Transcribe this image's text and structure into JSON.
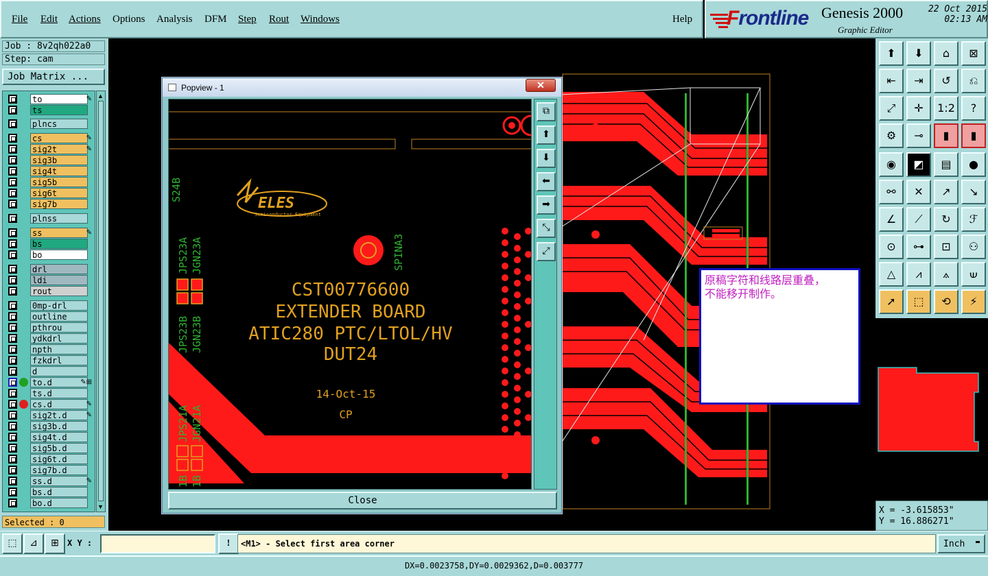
{
  "menu": {
    "file": "File",
    "edit": "Edit",
    "actions": "Actions",
    "options": "Options",
    "analysis": "Analysis",
    "dfm": "DFM",
    "step": "Step",
    "rout": "Rout",
    "windows": "Windows",
    "help": "Help"
  },
  "brand": {
    "logo_f": "F",
    "logo_rest": "rontline",
    "product": "Genesis 2000",
    "subtitle": "Graphic Editor",
    "date": "22 Oct 2015",
    "time": "02:13 AM"
  },
  "left": {
    "job": "Job : 8v2qh022a0",
    "step": "Step: cam",
    "job_matrix": "Job Matrix ...",
    "selected": "Selected : 0",
    "layers": [
      {
        "name": "to",
        "color": "#ffffff",
        "mark": "✎"
      },
      {
        "name": "ts",
        "color": "#20a880",
        "mark": ""
      },
      {
        "name": "plncs",
        "color": "#a8d8d8",
        "mark": ""
      },
      {
        "name": "cs",
        "color": "#f0c060",
        "mark": "✎"
      },
      {
        "name": "sig2t",
        "color": "#f0c060",
        "mark": "✎"
      },
      {
        "name": "sig3b",
        "color": "#f0c060",
        "mark": ""
      },
      {
        "name": "sig4t",
        "color": "#f0c060",
        "mark": ""
      },
      {
        "name": "sig5b",
        "color": "#f0c060",
        "mark": ""
      },
      {
        "name": "sig6t",
        "color": "#f0c060",
        "mark": ""
      },
      {
        "name": "sig7b",
        "color": "#f0c060",
        "mark": ""
      },
      {
        "name": "plnss",
        "color": "#a8d8d8",
        "mark": ""
      },
      {
        "name": "ss",
        "color": "#f0c060",
        "mark": "✎"
      },
      {
        "name": "bs",
        "color": "#20a880",
        "mark": ""
      },
      {
        "name": "bo",
        "color": "#ffffff",
        "mark": ""
      },
      {
        "name": "drl",
        "color": "#a0b8c0",
        "mark": ""
      },
      {
        "name": "ldi",
        "color": "#a0b8c0",
        "mark": ""
      },
      {
        "name": "rout",
        "color": "#d0d0d0",
        "mark": ""
      },
      {
        "name": "0mp-drl",
        "color": "#a8d8d8",
        "mark": ""
      },
      {
        "name": "outline",
        "color": "#a8d8d8",
        "mark": ""
      },
      {
        "name": "pthrou",
        "color": "#a8d8d8",
        "mark": ""
      },
      {
        "name": "ydkdrl",
        "color": "#a8d8d8",
        "mark": ""
      },
      {
        "name": "npth",
        "color": "#a8d8d8",
        "mark": ""
      },
      {
        "name": "fzkdrl",
        "color": "#a8d8d8",
        "mark": ""
      },
      {
        "name": "d",
        "color": "#a8d8d8",
        "mark": ""
      },
      {
        "name": "to.d",
        "color": "#a8d8d8",
        "mark": "✎⊞",
        "dot": "#20a020",
        "sel": true
      },
      {
        "name": "ts.d",
        "color": "#a8d8d8",
        "mark": ""
      },
      {
        "name": "cs.d",
        "color": "#a8d8d8",
        "mark": "✎",
        "dot": "#e02020"
      },
      {
        "name": "sig2t.d",
        "color": "#a8d8d8",
        "mark": "✎"
      },
      {
        "name": "sig3b.d",
        "color": "#a8d8d8",
        "mark": ""
      },
      {
        "name": "sig4t.d",
        "color": "#a8d8d8",
        "mark": ""
      },
      {
        "name": "sig5b.d",
        "color": "#a8d8d8",
        "mark": ""
      },
      {
        "name": "sig6t.d",
        "color": "#a8d8d8",
        "mark": ""
      },
      {
        "name": "sig7b.d",
        "color": "#a8d8d8",
        "mark": ""
      },
      {
        "name": "ss.d",
        "color": "#a8d8d8",
        "mark": "✎"
      },
      {
        "name": "bs.d",
        "color": "#a8d8d8",
        "mark": ""
      },
      {
        "name": "bo.d",
        "color": "#a8d8d8",
        "mark": ""
      }
    ]
  },
  "popview": {
    "title": "Popview - 1",
    "close_x": "✕",
    "close": "Close",
    "board": {
      "logo": "ELES",
      "logo_sub": "Semiconductor Equipment",
      "line1": "CST00776600",
      "line2": "EXTENDER BOARD",
      "line3": "ATIC280 PTC/LTOL/HV",
      "line4": "DUT24",
      "date": "14-Oct-15",
      "initials": "CP",
      "labels": [
        "S24B",
        "JPS23A",
        "JGN23A",
        "JPS23B",
        "JGN23B",
        "JPS21A",
        "JGN21A",
        "SPINA3",
        "1B",
        "1B"
      ]
    }
  },
  "note": {
    "text1": "原稿字符和线路层重叠，",
    "text2": "不能移开制作。"
  },
  "coords": {
    "x": "X = -3.615853\"",
    "y": "Y = 16.886271\""
  },
  "cmd": {
    "xy_label": "X Y :",
    "xy_value": "",
    "prompt": "<M1> - Select first area corner",
    "units": "Inch"
  },
  "status": "DX=0.0023758,DY=0.0029362,D=0.003777",
  "colors": {
    "board_red": "#ff1a1a",
    "silk_gold": "#e0a020",
    "panel": "#a8d8d8"
  }
}
